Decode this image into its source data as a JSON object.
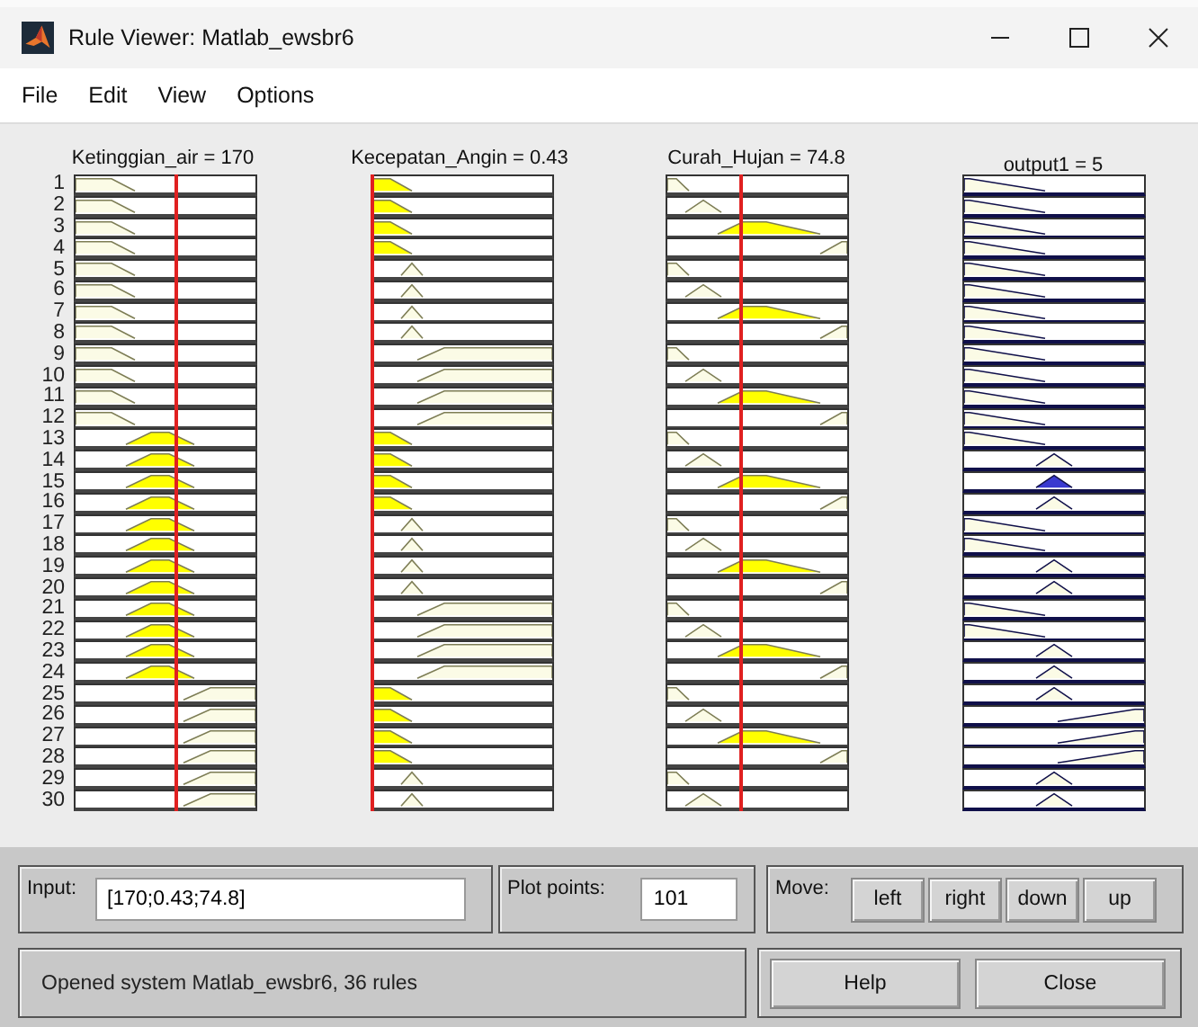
{
  "window": {
    "title": "Rule Viewer: Matlab_ewsbr6"
  },
  "menu": [
    "File",
    "Edit",
    "View",
    "Options"
  ],
  "columns": [
    "Ketinggian_air = 170",
    "Kecepatan_Angin = 0.43",
    "Curah_Hujan = 74.8",
    "output1 = 5"
  ],
  "rules": [
    {
      "number": "1",
      "cells": [
        {
          "kind": "low",
          "fired": false
        },
        {
          "kind": "low",
          "fired": true
        },
        {
          "kind": "low",
          "fired": false
        },
        {
          "kind": "low",
          "fired": false
        }
      ]
    },
    {
      "number": "2",
      "cells": [
        {
          "kind": "low",
          "fired": false
        },
        {
          "kind": "low",
          "fired": true
        },
        {
          "kind": "lowmid",
          "fired": false
        },
        {
          "kind": "low",
          "fired": false
        }
      ]
    },
    {
      "number": "3",
      "cells": [
        {
          "kind": "low",
          "fired": false
        },
        {
          "kind": "low",
          "fired": true
        },
        {
          "kind": "mid",
          "fired": true
        },
        {
          "kind": "low",
          "fired": false
        }
      ]
    },
    {
      "number": "4",
      "cells": [
        {
          "kind": "low",
          "fired": false
        },
        {
          "kind": "low",
          "fired": true
        },
        {
          "kind": "high",
          "fired": false
        },
        {
          "kind": "low",
          "fired": false
        }
      ]
    },
    {
      "number": "5",
      "cells": [
        {
          "kind": "low",
          "fired": false
        },
        {
          "kind": "mid",
          "fired": false
        },
        {
          "kind": "low",
          "fired": false
        },
        {
          "kind": "low",
          "fired": false
        }
      ]
    },
    {
      "number": "6",
      "cells": [
        {
          "kind": "low",
          "fired": false
        },
        {
          "kind": "mid",
          "fired": false
        },
        {
          "kind": "lowmid",
          "fired": false
        },
        {
          "kind": "low",
          "fired": false
        }
      ]
    },
    {
      "number": "7",
      "cells": [
        {
          "kind": "low",
          "fired": false
        },
        {
          "kind": "mid",
          "fired": false
        },
        {
          "kind": "mid",
          "fired": true
        },
        {
          "kind": "low",
          "fired": false
        }
      ]
    },
    {
      "number": "8",
      "cells": [
        {
          "kind": "low",
          "fired": false
        },
        {
          "kind": "mid",
          "fired": false
        },
        {
          "kind": "high",
          "fired": false
        },
        {
          "kind": "low",
          "fired": false
        }
      ]
    },
    {
      "number": "9",
      "cells": [
        {
          "kind": "low",
          "fired": false
        },
        {
          "kind": "high",
          "fired": false
        },
        {
          "kind": "low",
          "fired": false
        },
        {
          "kind": "low",
          "fired": false
        }
      ]
    },
    {
      "number": "10",
      "cells": [
        {
          "kind": "low",
          "fired": false
        },
        {
          "kind": "high",
          "fired": false
        },
        {
          "kind": "lowmid",
          "fired": false
        },
        {
          "kind": "low",
          "fired": false
        }
      ]
    },
    {
      "number": "11",
      "cells": [
        {
          "kind": "low",
          "fired": false
        },
        {
          "kind": "high",
          "fired": false
        },
        {
          "kind": "mid",
          "fired": true
        },
        {
          "kind": "low",
          "fired": false
        }
      ]
    },
    {
      "number": "12",
      "cells": [
        {
          "kind": "low",
          "fired": false
        },
        {
          "kind": "high",
          "fired": false
        },
        {
          "kind": "high",
          "fired": false
        },
        {
          "kind": "low",
          "fired": false
        }
      ]
    },
    {
      "number": "13",
      "cells": [
        {
          "kind": "mid",
          "fired": true
        },
        {
          "kind": "low",
          "fired": true
        },
        {
          "kind": "low",
          "fired": false
        },
        {
          "kind": "low",
          "fired": false
        }
      ]
    },
    {
      "number": "14",
      "cells": [
        {
          "kind": "mid",
          "fired": true
        },
        {
          "kind": "low",
          "fired": true
        },
        {
          "kind": "lowmid",
          "fired": false
        },
        {
          "kind": "mid",
          "fired": false
        }
      ]
    },
    {
      "number": "15",
      "cells": [
        {
          "kind": "mid",
          "fired": true
        },
        {
          "kind": "low",
          "fired": true
        },
        {
          "kind": "mid",
          "fired": true
        },
        {
          "kind": "mid",
          "fired": true
        }
      ]
    },
    {
      "number": "16",
      "cells": [
        {
          "kind": "mid",
          "fired": true
        },
        {
          "kind": "low",
          "fired": true
        },
        {
          "kind": "high",
          "fired": false
        },
        {
          "kind": "mid",
          "fired": false
        }
      ]
    },
    {
      "number": "17",
      "cells": [
        {
          "kind": "mid",
          "fired": true
        },
        {
          "kind": "mid",
          "fired": false
        },
        {
          "kind": "low",
          "fired": false
        },
        {
          "kind": "low",
          "fired": false
        }
      ]
    },
    {
      "number": "18",
      "cells": [
        {
          "kind": "mid",
          "fired": true
        },
        {
          "kind": "mid",
          "fired": false
        },
        {
          "kind": "lowmid",
          "fired": false
        },
        {
          "kind": "low",
          "fired": false
        }
      ]
    },
    {
      "number": "19",
      "cells": [
        {
          "kind": "mid",
          "fired": true
        },
        {
          "kind": "mid",
          "fired": false
        },
        {
          "kind": "mid",
          "fired": true
        },
        {
          "kind": "mid",
          "fired": false
        }
      ]
    },
    {
      "number": "20",
      "cells": [
        {
          "kind": "mid",
          "fired": true
        },
        {
          "kind": "mid",
          "fired": false
        },
        {
          "kind": "high",
          "fired": false
        },
        {
          "kind": "mid",
          "fired": false
        }
      ]
    },
    {
      "number": "21",
      "cells": [
        {
          "kind": "mid",
          "fired": true
        },
        {
          "kind": "high",
          "fired": false
        },
        {
          "kind": "low",
          "fired": false
        },
        {
          "kind": "low",
          "fired": false
        }
      ]
    },
    {
      "number": "22",
      "cells": [
        {
          "kind": "mid",
          "fired": true
        },
        {
          "kind": "high",
          "fired": false
        },
        {
          "kind": "lowmid",
          "fired": false
        },
        {
          "kind": "low",
          "fired": false
        }
      ]
    },
    {
      "number": "23",
      "cells": [
        {
          "kind": "mid",
          "fired": true
        },
        {
          "kind": "high",
          "fired": false
        },
        {
          "kind": "mid",
          "fired": true
        },
        {
          "kind": "mid",
          "fired": false
        }
      ]
    },
    {
      "number": "24",
      "cells": [
        {
          "kind": "mid",
          "fired": true
        },
        {
          "kind": "high",
          "fired": false
        },
        {
          "kind": "high",
          "fired": false
        },
        {
          "kind": "mid",
          "fired": false
        }
      ]
    },
    {
      "number": "25",
      "cells": [
        {
          "kind": "high",
          "fired": false
        },
        {
          "kind": "low",
          "fired": true
        },
        {
          "kind": "low",
          "fired": false
        },
        {
          "kind": "mid",
          "fired": false
        }
      ]
    },
    {
      "number": "26",
      "cells": [
        {
          "kind": "high",
          "fired": false
        },
        {
          "kind": "low",
          "fired": true
        },
        {
          "kind": "lowmid",
          "fired": false
        },
        {
          "kind": "high",
          "fired": false
        }
      ]
    },
    {
      "number": "27",
      "cells": [
        {
          "kind": "high",
          "fired": false
        },
        {
          "kind": "low",
          "fired": true
        },
        {
          "kind": "mid",
          "fired": true
        },
        {
          "kind": "high",
          "fired": false
        }
      ]
    },
    {
      "number": "28",
      "cells": [
        {
          "kind": "high",
          "fired": false
        },
        {
          "kind": "low",
          "fired": true
        },
        {
          "kind": "high",
          "fired": false
        },
        {
          "kind": "high",
          "fired": false
        }
      ]
    },
    {
      "number": "29",
      "cells": [
        {
          "kind": "high",
          "fired": false
        },
        {
          "kind": "mid",
          "fired": false
        },
        {
          "kind": "low",
          "fired": false
        },
        {
          "kind": "mid",
          "fired": false
        }
      ]
    },
    {
      "number": "30",
      "cells": [
        {
          "kind": "high",
          "fired": false
        },
        {
          "kind": "mid",
          "fired": false
        },
        {
          "kind": "lowmid",
          "fired": false
        },
        {
          "kind": "mid",
          "fired": false
        }
      ]
    }
  ],
  "input": {
    "label": "Input:",
    "value": "[170;0.43;74.8]"
  },
  "plot_points": {
    "label": "Plot points:",
    "value": "101"
  },
  "move": {
    "label": "Move:",
    "buttons": [
      "left",
      "right",
      "down",
      "up"
    ]
  },
  "status": "Opened system Matlab_ewsbr6, 36 rules",
  "buttons": [
    "Help",
    "Close"
  ]
}
